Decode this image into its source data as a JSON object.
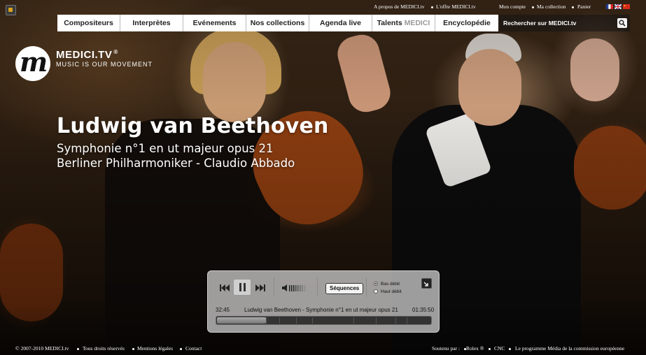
{
  "top_links": {
    "about": "A propos de MEDICI.tv",
    "offer": "L'offre MEDICI.tv",
    "account": "Mon compte",
    "collection": "Ma collection",
    "cart": "Panier"
  },
  "nav": {
    "items": [
      {
        "label": "Compositeurs"
      },
      {
        "label": "Interprètes"
      },
      {
        "label": "Evénements"
      },
      {
        "label": "Nos collections"
      },
      {
        "label": "Agenda live"
      },
      {
        "label": "Talents",
        "brand": "MEDICI"
      },
      {
        "label": "Encyclopédie"
      }
    ]
  },
  "search": {
    "placeholder": "Rechercher sur MEDICI.tv"
  },
  "logo": {
    "name": "MEDICI.TV",
    "tagline": "MUSIC IS OUR MOVEMENT",
    "mark": "m"
  },
  "hero": {
    "title": "Ludwig van Beethoven",
    "subtitle": "Symphonie n°1 en ut majeur opus 21",
    "performers": "Berliner Philharmoniker - Claudio Abbado"
  },
  "player": {
    "sequences_label": "Séquences",
    "quality_options": [
      {
        "label": "Bas débit",
        "selected": true
      },
      {
        "label": "Haut débit",
        "selected": false
      }
    ],
    "elapsed": "32:45",
    "now_playing": "Ludwig van Beethoven - Symphonie n°1 en ut majeur opus 21",
    "duration": "01:35:50",
    "progress": 0.23
  },
  "footer": {
    "copyright": "© 2007-2010 MEDICI.tv",
    "rights": "Tous droits réservés",
    "legal": "Mentions légales",
    "contact": "Contact",
    "sponsored_by": "Soutenu par :",
    "sponsor1": "Rolex ®",
    "sponsor2": "CNC",
    "sponsor3": "Le programme Média de la commission européenne"
  },
  "colors": {
    "accent": "#d9a31d",
    "nav_bg": "#ffffff",
    "nav_text": "#222222"
  }
}
